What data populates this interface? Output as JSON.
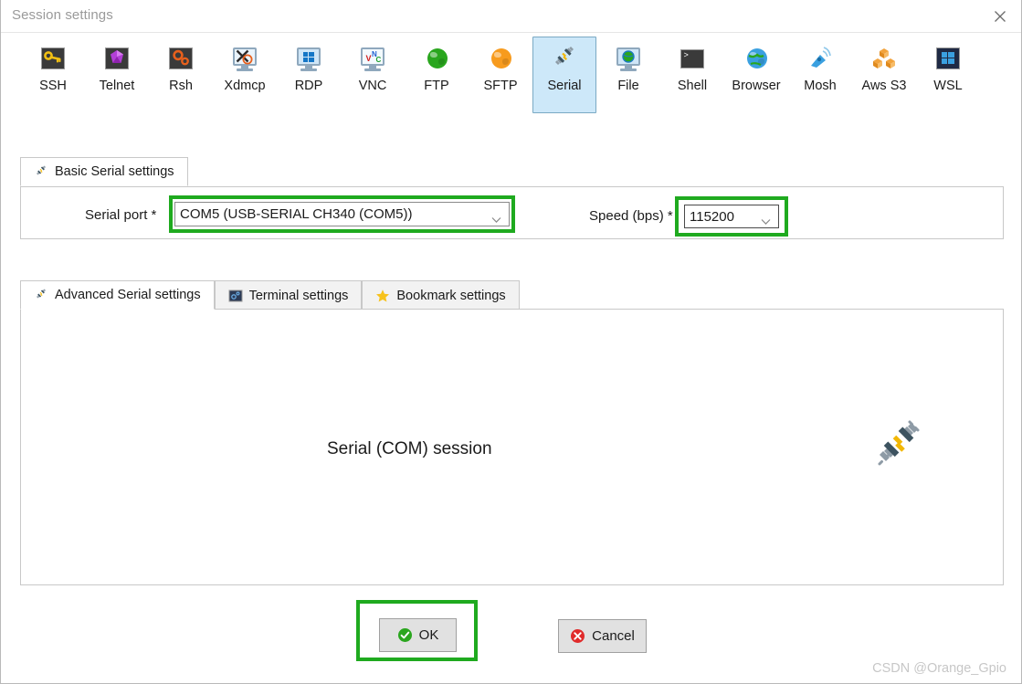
{
  "window": {
    "title": "Session settings",
    "close_icon": "close-icon"
  },
  "session_types": {
    "selected": "Serial",
    "items": [
      {
        "label": "SSH",
        "icon": "ssh-key-icon"
      },
      {
        "label": "Telnet",
        "icon": "telnet-gem-icon"
      },
      {
        "label": "Rsh",
        "icon": "rsh-gears-icon"
      },
      {
        "label": "Xdmcp",
        "icon": "xdmcp-monitor-icon"
      },
      {
        "label": "RDP",
        "icon": "rdp-monitor-icon"
      },
      {
        "label": "VNC",
        "icon": "vnc-monitor-icon"
      },
      {
        "label": "FTP",
        "icon": "ftp-globe-icon"
      },
      {
        "label": "SFTP",
        "icon": "sftp-globe-icon"
      },
      {
        "label": "Serial",
        "icon": "serial-plug-icon"
      },
      {
        "label": "File",
        "icon": "file-monitor-icon"
      },
      {
        "label": "Shell",
        "icon": "shell-console-icon"
      },
      {
        "label": "Browser",
        "icon": "browser-globe-icon"
      },
      {
        "label": "Mosh",
        "icon": "mosh-satellite-icon"
      },
      {
        "label": "Aws S3",
        "icon": "aws-s3-cubes-icon"
      },
      {
        "label": "WSL",
        "icon": "wsl-windows-icon"
      }
    ]
  },
  "basic_tab": {
    "label": "Basic Serial settings",
    "icon": "serial-plug-icon"
  },
  "form": {
    "serial_port": {
      "label": "Serial port",
      "required_marker": "*",
      "value": "COM5  (USB-SERIAL CH340 (COM5))",
      "highlight_color": "#1faa1f"
    },
    "speed": {
      "label": "Speed (bps)",
      "required_marker": "*",
      "value": "115200",
      "highlight_color": "#1faa1f"
    }
  },
  "sub_tabs": {
    "items": [
      {
        "label": "Advanced Serial settings",
        "icon": "serial-plug-icon",
        "active": true
      },
      {
        "label": "Terminal settings",
        "icon": "terminal-icon",
        "active": false
      },
      {
        "label": "Bookmark settings",
        "icon": "star-icon",
        "active": false
      }
    ]
  },
  "content": {
    "caption": "Serial (COM) session",
    "illustration_icon": "serial-plug-icon"
  },
  "buttons": {
    "ok": {
      "label": "OK",
      "icon": "check-circle-icon",
      "highlighted": true
    },
    "cancel": {
      "label": "Cancel",
      "icon": "cancel-circle-icon",
      "highlighted": false
    }
  },
  "watermark": "CSDN @Orange_Gpio"
}
